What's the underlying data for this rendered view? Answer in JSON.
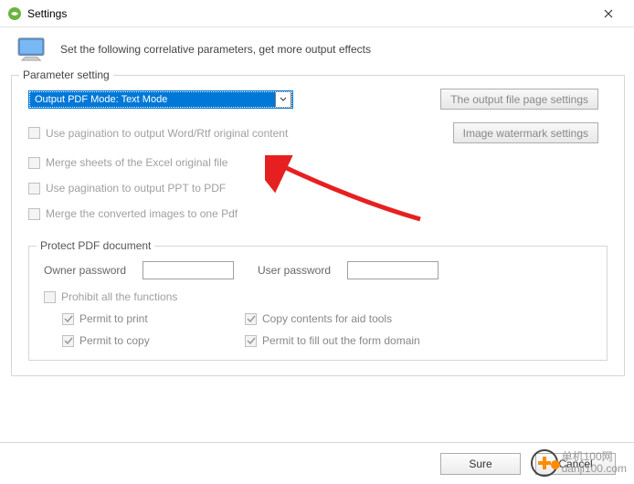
{
  "window": {
    "title": "Settings"
  },
  "header": {
    "text": "Set the following correlative parameters, get more output effects"
  },
  "fieldset": {
    "legend": "Parameter setting",
    "dropdown": "Output PDF Mode: Text Mode",
    "btn_page_settings": "The output file page settings",
    "btn_watermark": "Image watermark settings",
    "chk1": "Use pagination to output Word/Rtf original content",
    "chk2": "Merge sheets of the Excel original file",
    "chk3": "Use pagination to output PPT to PDF",
    "chk4": "Merge the converted images to one Pdf"
  },
  "protect": {
    "legend": "Protect PDF document",
    "owner_label": "Owner password",
    "user_label": "User password",
    "prohibit": "Prohibit all the functions",
    "p_print": "Permit to print",
    "p_copy_aid": "Copy contents for aid tools",
    "p_copy": "Permit to copy",
    "p_form": "Permit to fill out the form domain"
  },
  "buttons": {
    "sure": "Sure",
    "cancel": "Cancel"
  },
  "watermark": "单机100网\ndanji100.com"
}
